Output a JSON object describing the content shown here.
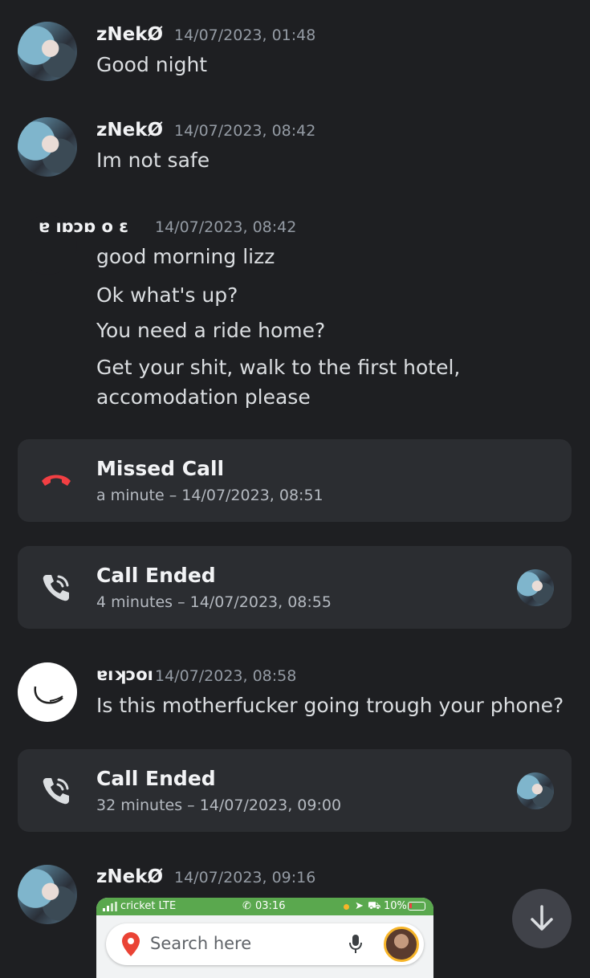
{
  "messages": [
    {
      "author": "zNekØ",
      "timestamp": "14/07/2023, 01:48",
      "text": "Good night"
    },
    {
      "author": "zNekØ",
      "timestamp": "14/07/2023, 08:42",
      "text": "Im not safe"
    },
    {
      "author": "ɐ ıɒɔɒ o ɛ",
      "timestamp": "14/07/2023, 08:42",
      "lines": [
        "good morning lizz",
        "Ok what's up?",
        "You need a ride home?",
        "Get your shit, walk to the first hotel,",
        "accomodation please"
      ]
    },
    {
      "author": "ɐıʞɔoı",
      "timestamp": "14/07/2023, 08:58",
      "text": "Is this motherfucker going trough your phone?"
    },
    {
      "author": "zNekØ",
      "timestamp": "14/07/2023, 09:16"
    }
  ],
  "calls": [
    {
      "title": "Missed Call",
      "detail": "a minute – 14/07/2023, 08:51",
      "status_color": "#f23f43"
    },
    {
      "title": "Call Ended",
      "detail": "4 minutes – 14/07/2023, 08:55"
    },
    {
      "title": "Call Ended",
      "detail": "32 minutes – 14/07/2023, 09:00"
    }
  ],
  "attachment": {
    "carrier": "cricket  LTE",
    "call_time": "03:16",
    "battery": "10%",
    "search_placeholder": "Search here"
  },
  "colors": {
    "background": "#1e1f22",
    "card": "#2b2d31",
    "missed": "#f23f43",
    "maps_status": "#5aa84e"
  }
}
